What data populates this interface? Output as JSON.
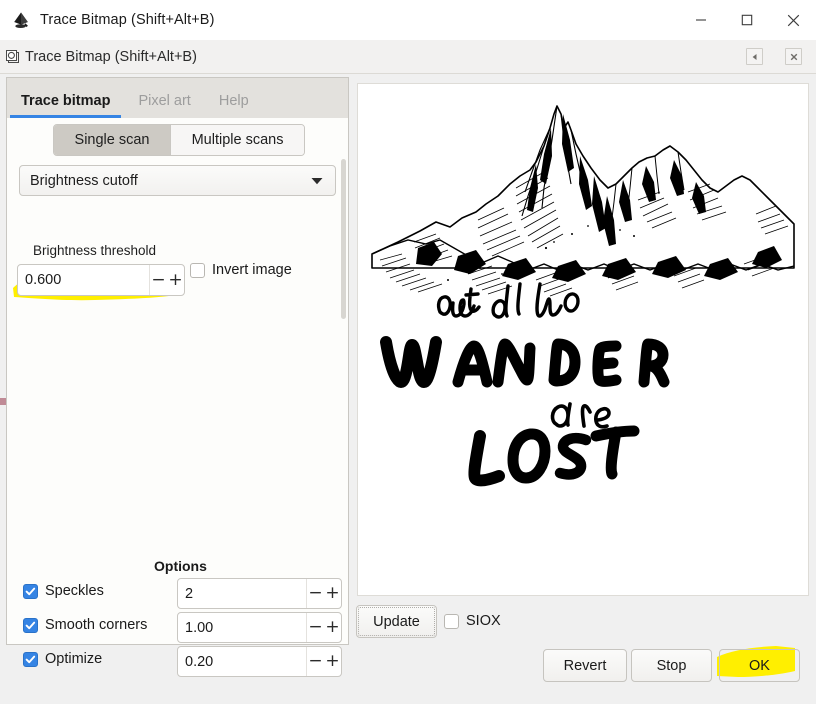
{
  "window": {
    "title": "Trace Bitmap (Shift+Alt+B)",
    "app_icon": "inkscape-logo-icon",
    "controls": {
      "minimize_label": "Minimize",
      "maximize_label": "Maximize",
      "close_label": "Close"
    }
  },
  "dock": {
    "title": "Trace Bitmap (Shift+Alt+B)",
    "icon": "dialog-trace-icon",
    "collapse_label": "Collapse dock",
    "close_label": "Close dock"
  },
  "tabs": [
    {
      "label": "Trace bitmap",
      "active": true
    },
    {
      "label": "Pixel art",
      "active": false
    },
    {
      "label": "Help",
      "active": false
    }
  ],
  "scan_mode": {
    "options": [
      {
        "label": "Single scan",
        "selected": true
      },
      {
        "label": "Multiple scans",
        "selected": false
      }
    ]
  },
  "detection_mode": {
    "value": "Brightness cutoff",
    "arrow_icon": "chevron-down-icon"
  },
  "brightness": {
    "label": "Brightness threshold",
    "value": "0.600",
    "minus_label": "−",
    "plus_label": "+",
    "highlighted": true
  },
  "invert_image": {
    "label": "Invert image",
    "checked": false
  },
  "options": {
    "title": "Options",
    "rows": [
      {
        "label": "Speckles",
        "checked": true,
        "value": "2"
      },
      {
        "label": "Smooth corners",
        "checked": true,
        "value": "1.00"
      },
      {
        "label": "Optimize",
        "checked": true,
        "value": "0.20"
      }
    ],
    "minus_label": "−",
    "plus_label": "+"
  },
  "preview": {
    "update_label": "Update",
    "siox": {
      "label": "SIOX",
      "checked": false
    },
    "artwork": {
      "description": "Hand-drawn mountain range above brush-lettered quote",
      "line1": "not all who",
      "line2": "WANDER",
      "line3": "are",
      "line4": "LOST"
    }
  },
  "footer": {
    "buttons": [
      {
        "label": "Revert",
        "highlighted": false
      },
      {
        "label": "Stop",
        "highlighted": false
      },
      {
        "label": "OK",
        "highlighted": true
      }
    ]
  },
  "colors": {
    "accent": "#3584e4",
    "highlight": "#ffef00",
    "titlebar_bg": "#ffffff",
    "panel_bg": "#fdfdfb",
    "dock_bg": "#f2f1f0",
    "tabstrip_bg": "#e3e1dd",
    "window_bg": "#f0f0f0"
  }
}
